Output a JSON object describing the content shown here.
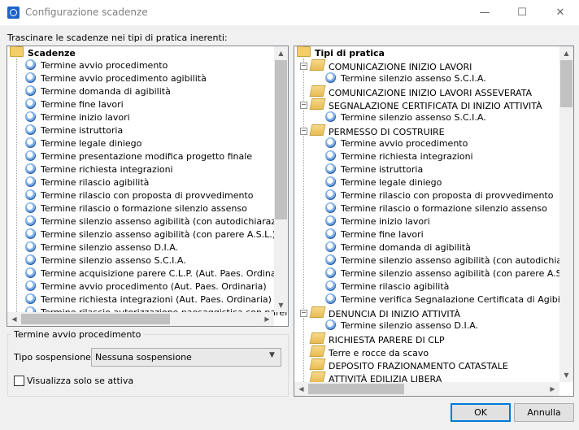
{
  "window": {
    "title": "Configurazione scadenze",
    "minimize": "—",
    "maximize": "☐",
    "close": "✕"
  },
  "instruction": "Trascinare le scadenze nei tipi di pratica inerenti:",
  "left_tree": {
    "root": "Scadenze",
    "items": [
      "Termine avvio procedimento",
      "Termine avvio procedimento agibilità",
      "Termine domanda di agibilità",
      "Termine fine lavori",
      "Termine inizio lavori",
      "Termine istruttoria",
      "Termine legale diniego",
      "Termine presentazione modifica progetto finale",
      "Termine richiesta integrazioni",
      "Termine rilascio agibilità",
      "Termine rilascio con proposta di provvedimento",
      "Termine rilascio o formazione silenzio assenso",
      "Termine silenzio assenso agibilità (con autodichiarazione)",
      "Termine silenzio assenso agibilità (con parere A.S.L.)",
      "Termine silenzio assenso D.I.A.",
      "Termine silenzio assenso S.C.I.A.",
      "Termine acquisizione parere C.L.P. (Aut. Paes. Ordinaria)",
      "Termine avvio procedimento (Aut. Paes. Ordinaria)",
      "Termine richiesta integrazioni (Aut. Paes. Ordinaria)",
      "Termine rilascio autorizzazione paesaggistica con parere dell"
    ]
  },
  "right_tree": {
    "root": "Tipi di pratica",
    "rows": [
      {
        "level": 1,
        "kind": "folder",
        "expander": "−",
        "label": "COMUNICAZIONE INIZIO LAVORI"
      },
      {
        "level": 2,
        "kind": "clock",
        "label": "Termine silenzio assenso S.C.I.A."
      },
      {
        "level": 1,
        "kind": "folder",
        "label": "COMUNICAZIONE INIZIO LAVORI ASSEVERATA"
      },
      {
        "level": 1,
        "kind": "folder",
        "expander": "−",
        "label": "SEGNALAZIONE CERTIFICATA DI INIZIO ATTIVITÀ"
      },
      {
        "level": 2,
        "kind": "clock",
        "label": "Termine silenzio assenso S.C.I.A."
      },
      {
        "level": 1,
        "kind": "folder",
        "expander": "−",
        "label": "PERMESSO DI COSTRUIRE"
      },
      {
        "level": 2,
        "kind": "clock",
        "label": "Termine avvio procedimento"
      },
      {
        "level": 2,
        "kind": "clock",
        "label": "Termine richiesta integrazioni"
      },
      {
        "level": 2,
        "kind": "clock",
        "label": "Termine istruttoria"
      },
      {
        "level": 2,
        "kind": "clock",
        "label": "Termine legale diniego"
      },
      {
        "level": 2,
        "kind": "clock",
        "label": "Termine rilascio con proposta di provvedimento"
      },
      {
        "level": 2,
        "kind": "clock",
        "label": "Termine rilascio o formazione silenzio assenso"
      },
      {
        "level": 2,
        "kind": "clock",
        "label": "Termine inizio lavori"
      },
      {
        "level": 2,
        "kind": "clock",
        "label": "Termine fine lavori"
      },
      {
        "level": 2,
        "kind": "clock",
        "label": "Termine domanda di agibilità"
      },
      {
        "level": 2,
        "kind": "clock",
        "label": "Termine silenzio assenso agibilità (con autodichiarazione)"
      },
      {
        "level": 2,
        "kind": "clock",
        "label": "Termine silenzio assenso agibilità (con parere A.S.L.)"
      },
      {
        "level": 2,
        "kind": "clock",
        "label": "Termine rilascio agibilità"
      },
      {
        "level": 2,
        "kind": "clock",
        "label": "Termine verifica Segnalazione Certificata di Agibilità"
      },
      {
        "level": 1,
        "kind": "folder",
        "expander": "−",
        "label": "DENUNCIA DI INIZIO ATTIVITÀ"
      },
      {
        "level": 2,
        "kind": "clock",
        "label": "Termine silenzio assenso D.I.A."
      },
      {
        "level": 1,
        "kind": "folder",
        "label": "RICHIESTA PARERE DI CLP"
      },
      {
        "level": 1,
        "kind": "folder",
        "label": "Terre e rocce da scavo"
      },
      {
        "level": 1,
        "kind": "folder",
        "label": "DEPOSITO FRAZIONAMENTO CATASTALE"
      },
      {
        "level": 1,
        "kind": "folder",
        "label": "ATTIVITÀ EDILIZIA LIBERA"
      }
    ]
  },
  "detail": {
    "group_title": "Termine avvio procedimento",
    "suspension_label": "Tipo sospensione:",
    "suspension_value": "Nessuna sospensione",
    "checkbox_label": "Visualizza solo se attiva",
    "checkbox_checked": false
  },
  "buttons": {
    "ok": "OK",
    "cancel": "Annulla"
  },
  "scroll_arrows": {
    "up": "▲",
    "down": "▼",
    "left": "◀",
    "right": "▶"
  }
}
